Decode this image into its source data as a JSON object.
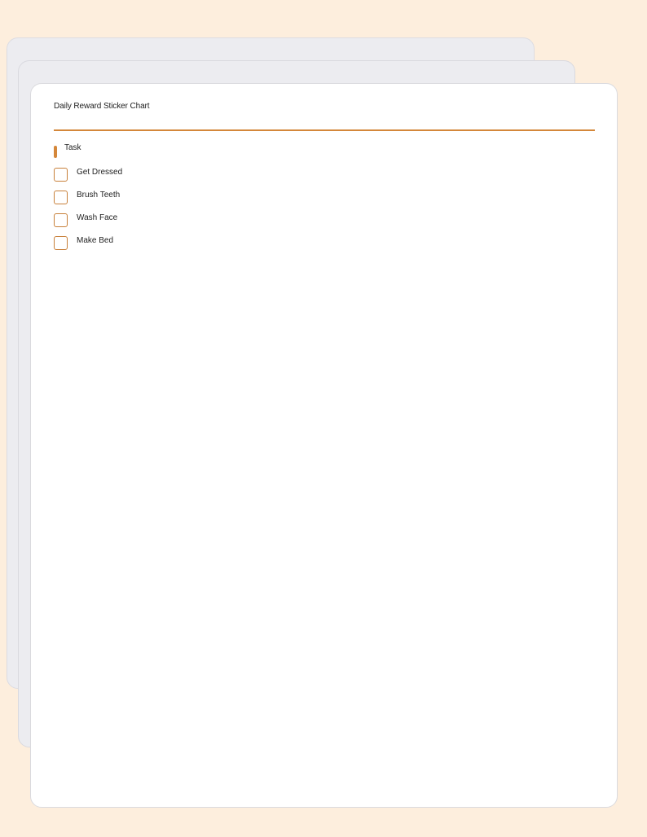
{
  "document": {
    "title": "Daily Reward Sticker Chart",
    "section_heading": "Task",
    "tasks": [
      {
        "label": "Get Dressed",
        "checked": false
      },
      {
        "label": "Brush Teeth",
        "checked": false
      },
      {
        "label": "Wash Face",
        "checked": false
      },
      {
        "label": "Make Bed",
        "checked": false
      }
    ]
  },
  "colors": {
    "background": "#fdeedd",
    "accent": "#d4873a",
    "back_sheet": "#ececf0",
    "front_sheet": "#ffffff"
  }
}
